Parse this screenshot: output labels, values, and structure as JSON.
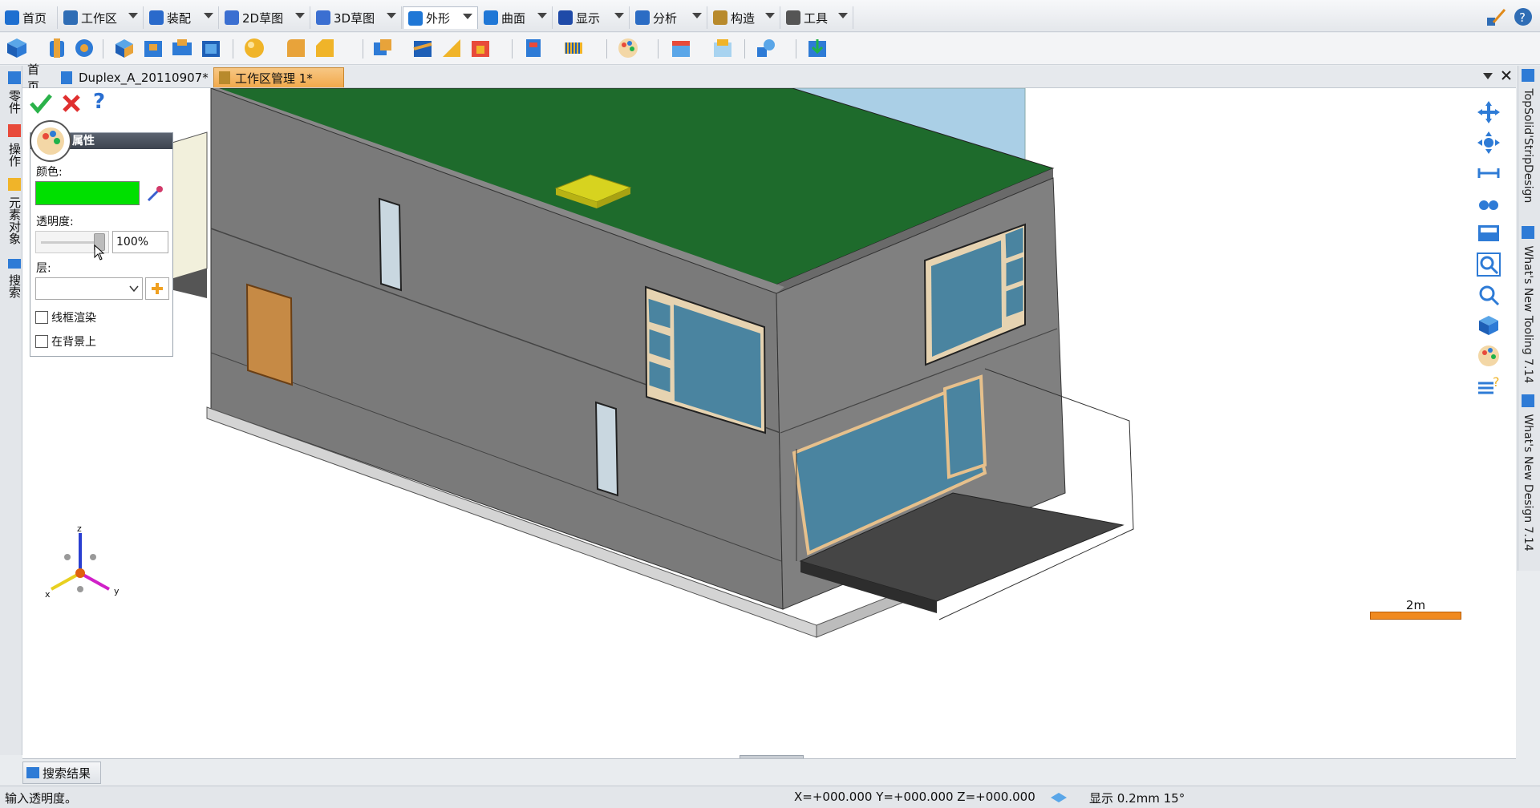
{
  "menu": {
    "tabs": [
      {
        "label": "首页",
        "color": "#1e6fd0"
      },
      {
        "label": "工作区",
        "color": "#2f6db5"
      },
      {
        "label": "装配",
        "color": "#2a6acb"
      },
      {
        "label": "2D草图",
        "color": "#3b6fd1"
      },
      {
        "label": "3D草图",
        "color": "#3b6fd1"
      },
      {
        "label": "外形",
        "color": "#1f77d6"
      },
      {
        "label": "曲面",
        "color": "#1f77d6"
      },
      {
        "label": "显示",
        "color": "#1f4aa8"
      },
      {
        "label": "分析",
        "color": "#2b6cc4"
      },
      {
        "label": "构造",
        "color": "#b88a2c"
      },
      {
        "label": "工具",
        "color": "#555555"
      }
    ]
  },
  "doc_tabs": [
    {
      "label": "首页"
    },
    {
      "label": "Duplex_A_20110907*"
    },
    {
      "label": "工作区管理 1*"
    }
  ],
  "left_rail": [
    "零件",
    "操作",
    "元素对象",
    "搜索"
  ],
  "right_rail": [
    "TopSolid'StripDesign",
    "What's New Tooling 7.14",
    "What's New Design 7.14"
  ],
  "props": {
    "title": "属性",
    "color_label": "颜色:",
    "color_value": "#00e000",
    "transparency_label": "透明度:",
    "transparency_value": "100%",
    "layer_label": "层:",
    "layer_value": "",
    "wireframe_label": "线框渲染",
    "background_label": "在背景上"
  },
  "axes": {
    "z": "z",
    "x": "x",
    "y": "y"
  },
  "scale_label": "2m",
  "bottom_tab": "搜索结果",
  "status": {
    "hint": "输入透明度。",
    "coords": "X=+000.000  Y=+000.000  Z=+000.000",
    "display": "显示 0.2mm 15°"
  },
  "colors": {
    "roof": "#1f6a2d",
    "wall": "#7b7b7b",
    "glass": "#4a84a0",
    "accent_tab": "#f2a94b"
  }
}
